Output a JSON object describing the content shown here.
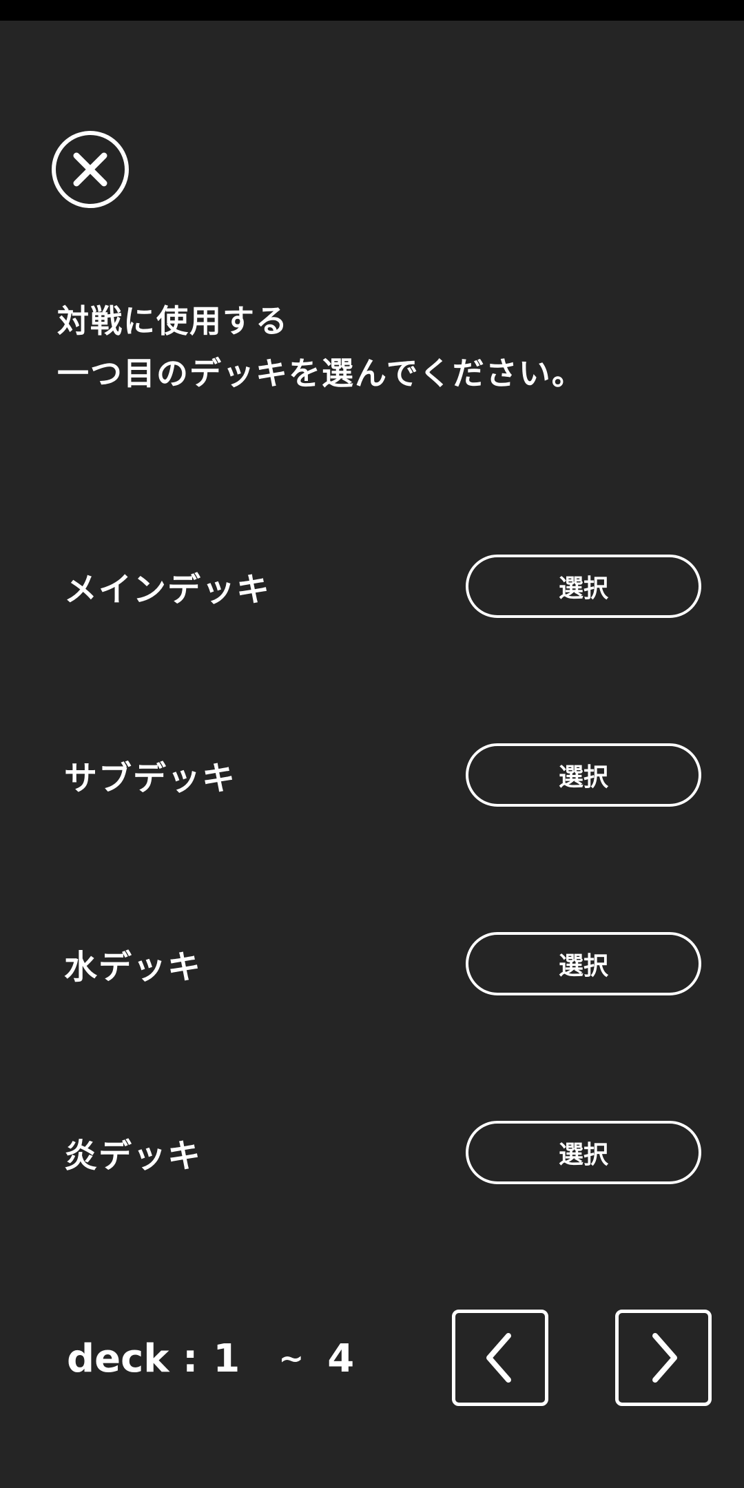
{
  "header": {
    "close_icon": "close-circle-icon",
    "title_line1": "対戦に使用する",
    "title_line2": "一つ目のデッキを選んでください。"
  },
  "decks": [
    {
      "name": "メインデッキ",
      "select_label": "選択"
    },
    {
      "name": "サブデッキ",
      "select_label": "選択"
    },
    {
      "name": "水デッキ",
      "select_label": "選択"
    },
    {
      "name": "炎デッキ",
      "select_label": "選択"
    }
  ],
  "pager": {
    "prefix": "deck :",
    "start": "1",
    "separator": "~",
    "end": "4",
    "prev_icon": "chevron-left-icon",
    "next_icon": "chevron-right-icon"
  },
  "colors": {
    "background": "#252525",
    "status_bar": "#000000",
    "foreground": "#ffffff"
  }
}
